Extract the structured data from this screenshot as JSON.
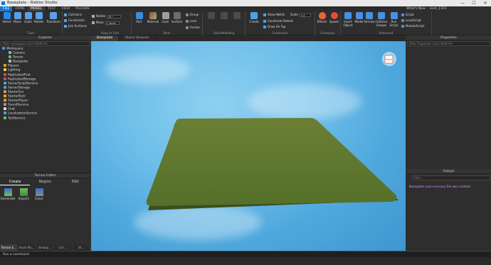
{
  "window": {
    "title": "Baseplate - Roblox Studio",
    "minimize": "—",
    "maximize": "☐",
    "close": "✕"
  },
  "menu": {
    "items": [
      "FILE",
      "HOME",
      "MODEL",
      "TEST",
      "VIEW",
      "PLUGINS"
    ],
    "active": "MODEL",
    "right": {
      "whats_new": "What's New",
      "user": "ssnh_1101"
    }
  },
  "ribbon": {
    "tools": {
      "select": "Select",
      "move": "Move",
      "scale": "Scale",
      "rotate": "Rotate",
      "transform": "Transform",
      "collisions": "Collisions",
      "constraints": "Constraints",
      "join_surfaces": "Join Surfaces",
      "rotate_label": "Rotate",
      "rotate_value": "45 °",
      "move_label": "Move",
      "move_value": "1 studs",
      "part": "Part",
      "material": "Material",
      "color": "Color",
      "surface": "Surface",
      "group": "Group",
      "lock": "Lock",
      "anchor": "Anchor",
      "show_welds": "Show Welds",
      "scale_label": "Scale",
      "scale_value": "1.4",
      "constraint_details": "Constraint Details",
      "draw_on_top": "Draw On Top",
      "create": "Create",
      "effects": "Effects",
      "spawn": "Spawn",
      "insert_object": "Insert Object",
      "model": "Model",
      "service": "Service",
      "collision_groups": "Collision Groups",
      "run_script": "Run Script",
      "script": "Script",
      "local_script": "LocalScript",
      "module_script": "ModuleScript"
    },
    "groups": {
      "tools": "Tools",
      "snap": "Snap to Grid",
      "parts": "Parts",
      "solid": "Solid Modeling",
      "constraints": "Constraints",
      "gameplay": "Gameplay",
      "advanced": "Advanced"
    }
  },
  "explorer": {
    "title": "Explorer",
    "filter": "Filter workspace (Ctrl+Shift+X)",
    "nodes": [
      "Workspace",
      "Camera",
      "Terrain",
      "Baseplate",
      "Players",
      "Lighting",
      "ReplicatedFirst",
      "ReplicatedStorage",
      "ServerScriptService",
      "ServerStorage",
      "StarterGui",
      "StarterPack",
      "StarterPlayer",
      "SoundService",
      "Chat",
      "LocalizationService",
      "TestService"
    ]
  },
  "terrain": {
    "title": "Terrain Editor",
    "tabs": [
      "Create",
      "Region",
      "Edit"
    ],
    "tools": [
      "Generate",
      "Import",
      "Clear"
    ]
  },
  "bottom_tabs": [
    "Terrain E...",
    "Asset Ma...",
    "Breakp...",
    "Call ...",
    "W..."
  ],
  "command_bar": {
    "placeholder": "Run a command"
  },
  "doc_tabs": [
    "Baseplate",
    "Object Browser"
  ],
  "properties": {
    "title": "Properties",
    "filter": "Filter Properties (Ctrl+Shift+P)"
  },
  "output": {
    "title": "Output",
    "filter": "Filter...",
    "message": "Baseplate auto-recovery file was created"
  },
  "view_cube": {
    "label": "Front"
  },
  "colors": {
    "sky_top": "#8fd0f0",
    "sky_bottom": "#3f96d0",
    "grass": "#5f7a2c",
    "accent": "#1c76c9",
    "output_msg": "#d58dff"
  }
}
